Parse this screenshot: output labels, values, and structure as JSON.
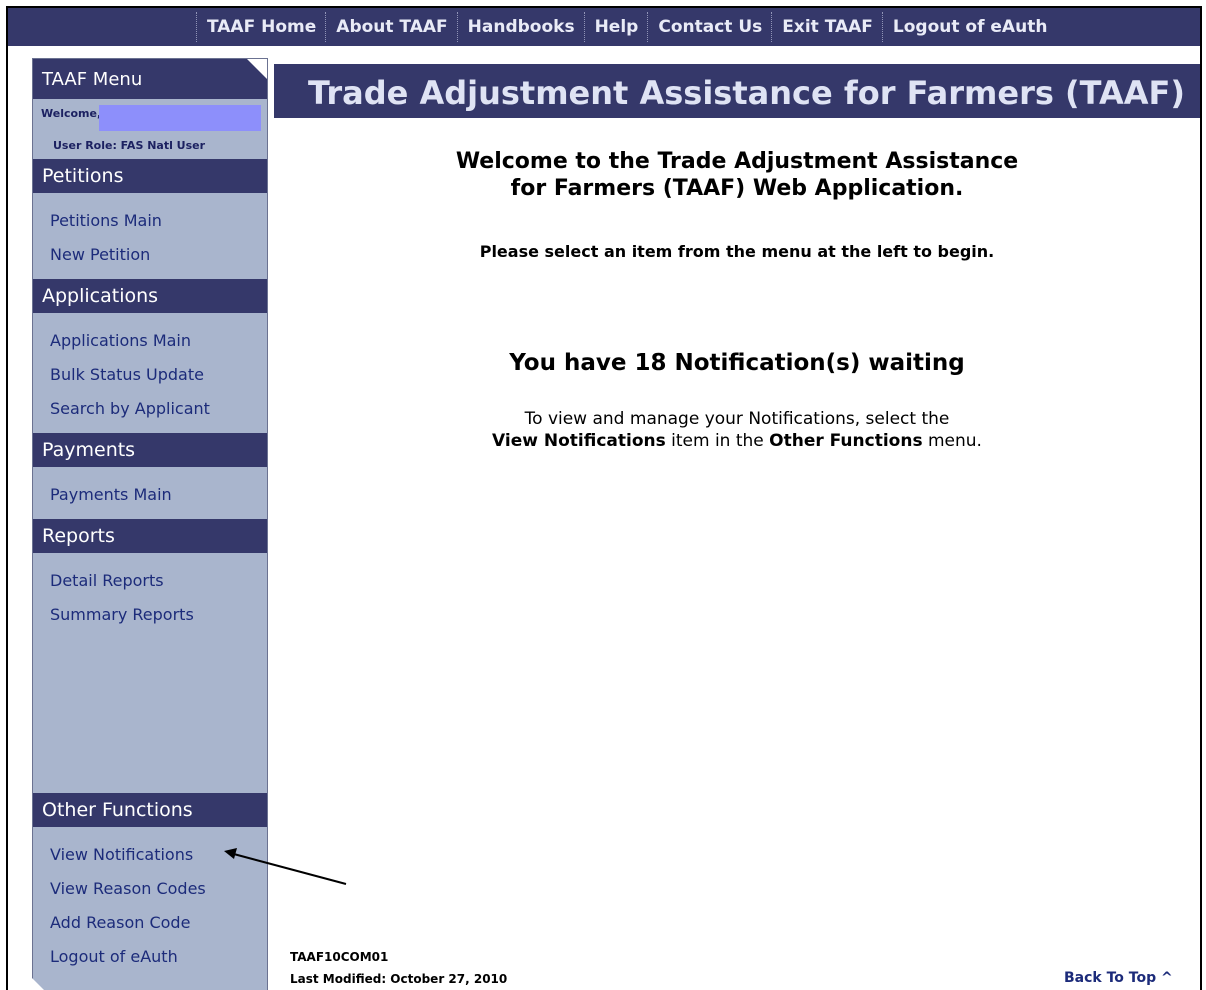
{
  "top_nav": [
    "TAAF Home",
    "About TAAF",
    "Handbooks",
    "Help",
    "Contact Us",
    "Exit TAAF",
    "Logout of eAuth"
  ],
  "sidebar": {
    "menu_title": "TAAF Menu",
    "welcome_label": "Welcome,",
    "user_role": "User Role: FAS Natl User",
    "sections": [
      {
        "title": "Petitions",
        "items": [
          "Petitions Main",
          "New Petition"
        ]
      },
      {
        "title": "Applications",
        "items": [
          "Applications Main",
          "Bulk Status Update",
          "Search by Applicant"
        ]
      },
      {
        "title": "Payments",
        "items": [
          "Payments Main"
        ]
      },
      {
        "title": "Reports",
        "items": [
          "Detail Reports",
          "Summary Reports"
        ]
      },
      {
        "title": "Other Functions",
        "items": [
          "View Notifications",
          "View Reason Codes",
          "Add Reason Code",
          "Logout of eAuth"
        ]
      }
    ]
  },
  "main": {
    "banner_title": "Trade Adjustment Assistance for Farmers (TAAF)",
    "welcome_line1": "Welcome to the Trade Adjustment Assistance",
    "welcome_line2": "for Farmers (TAAF) Web Application.",
    "instruction": "Please select an item from the menu at the left to begin.",
    "notification_heading": "You have 18 Notification(s) waiting",
    "notification_line1": "To view and manage your Notifications, select the",
    "notification_bold1": "View Notifications",
    "notification_mid": " item in the ",
    "notification_bold2": "Other Functions",
    "notification_end": " menu."
  },
  "footer": {
    "page_code": "TAAF10COM01",
    "last_modified": "Last Modified: October 27, 2010",
    "back_to_top": "Back To Top ^"
  },
  "colors": {
    "nav_bg": "#35386a",
    "sidebar_bg": "#a9b5cd",
    "link": "#1c2b7a",
    "welcome_highlight": "#8d8ffb"
  }
}
